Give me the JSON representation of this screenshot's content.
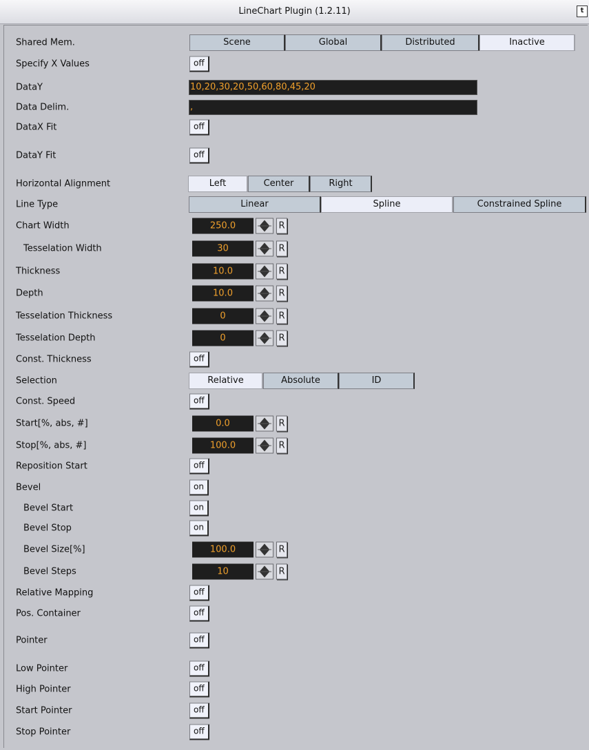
{
  "window": {
    "title": "LineChart Plugin (1.2.11)",
    "icon": "plugin-badge-icon"
  },
  "shared_mem": {
    "label": "Shared Mem.",
    "options": [
      "Scene",
      "Global",
      "Distributed",
      "Inactive"
    ],
    "selected": "Inactive"
  },
  "specify_x": {
    "label": "Specify X Values",
    "value": "off"
  },
  "datay": {
    "label": "DataY",
    "value": "10,20,30,20,50,60,80,45,20"
  },
  "data_delim": {
    "label": "Data Delim.",
    "value": ","
  },
  "datax_fit": {
    "label": "DataX Fit",
    "value": "off"
  },
  "datay_fit": {
    "label": "DataY Fit",
    "value": "off"
  },
  "h_align": {
    "label": "Horizontal Alignment",
    "options": [
      "Left",
      "Center",
      "Right"
    ],
    "selected": "Left"
  },
  "line_type": {
    "label": "Line Type",
    "options": [
      "Linear",
      "Spline",
      "Constrained Spline"
    ],
    "selected": "Spline"
  },
  "chart_width": {
    "label": "Chart Width",
    "value": "250.0",
    "reset": "R"
  },
  "tess_width": {
    "label": "Tesselation Width",
    "value": "30",
    "reset": "R"
  },
  "thickness": {
    "label": "Thickness",
    "value": "10.0",
    "reset": "R"
  },
  "depth": {
    "label": "Depth",
    "value": "10.0",
    "reset": "R"
  },
  "tess_thickness": {
    "label": "Tesselation Thickness",
    "value": "0",
    "reset": "R"
  },
  "tess_depth": {
    "label": "Tesselation Depth",
    "value": "0",
    "reset": "R"
  },
  "const_thickness": {
    "label": "Const. Thickness",
    "value": "off"
  },
  "selection": {
    "label": "Selection",
    "options": [
      "Relative",
      "Absolute",
      "ID"
    ],
    "selected": "Relative"
  },
  "const_speed": {
    "label": "Const. Speed",
    "value": "off"
  },
  "start": {
    "label": "Start[%, abs, #]",
    "value": "0.0",
    "reset": "R"
  },
  "stop": {
    "label": "Stop[%, abs, #]",
    "value": "100.0",
    "reset": "R"
  },
  "reposition_start": {
    "label": "Reposition Start",
    "value": "off"
  },
  "bevel": {
    "label": "Bevel",
    "value": "on"
  },
  "bevel_start": {
    "label": "Bevel Start",
    "value": "on"
  },
  "bevel_stop": {
    "label": "Bevel Stop",
    "value": "on"
  },
  "bevel_size": {
    "label": "Bevel Size[%]",
    "value": "100.0",
    "reset": "R"
  },
  "bevel_steps": {
    "label": "Bevel Steps",
    "value": "10",
    "reset": "R"
  },
  "relative_mapping": {
    "label": "Relative Mapping",
    "value": "off"
  },
  "pos_container": {
    "label": "Pos. Container",
    "value": "off"
  },
  "pointer": {
    "label": "Pointer",
    "value": "off"
  },
  "low_pointer": {
    "label": "Low Pointer",
    "value": "off"
  },
  "high_pointer": {
    "label": "High Pointer",
    "value": "off"
  },
  "start_pointer": {
    "label": "Start Pointer",
    "value": "off"
  },
  "stop_pointer": {
    "label": "Stop Pointer",
    "value": "off"
  }
}
